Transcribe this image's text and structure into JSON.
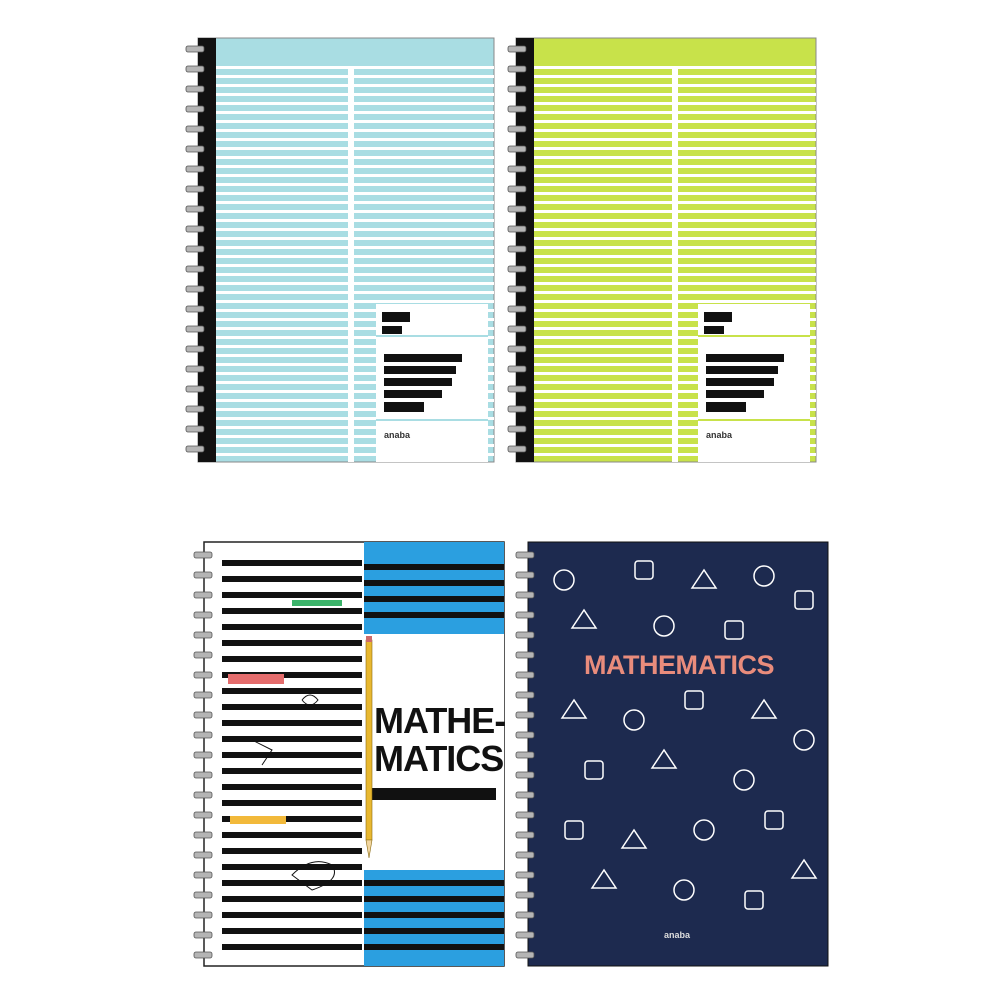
{
  "notebooks": [
    {
      "id": "blue-lined",
      "cover_color": "#a9dde3",
      "line_color": "#ffffff",
      "spine_color": "#111111",
      "brand": "anaba"
    },
    {
      "id": "green-lined",
      "cover_color": "#c8e24a",
      "line_color": "#ffffff",
      "spine_color": "#111111",
      "brand": "anaba"
    },
    {
      "id": "math-striped",
      "title_line1": "MATHE-",
      "title_line2": "MATICS",
      "accent_color": "#2b9fe0",
      "pencil_color": "#e8b830"
    },
    {
      "id": "math-navy",
      "title": "MATHEMATICS",
      "cover_color": "#1d2a4f",
      "title_color": "#e98c7c",
      "brand": "anaba"
    }
  ]
}
